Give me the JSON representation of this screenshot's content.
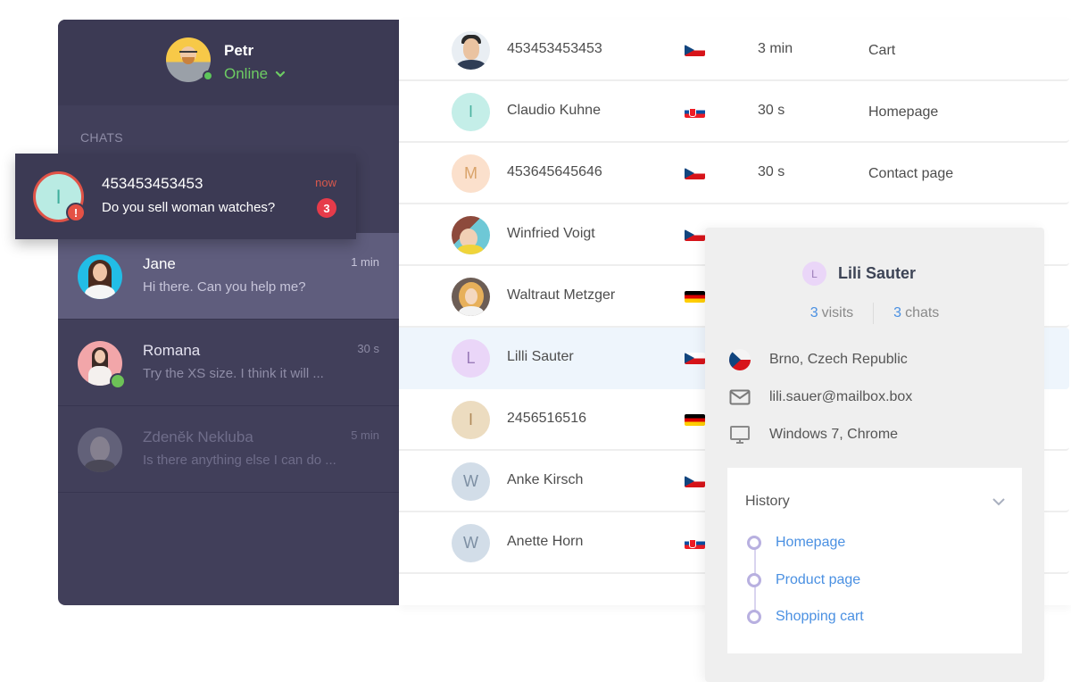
{
  "operator": {
    "name": "Petr",
    "status": "Online",
    "status_color": "#6dcc63"
  },
  "sidebar": {
    "section_label": "CHATS",
    "notification": {
      "avatar_letter": "I",
      "title": "453453453453",
      "message": "Do you sell woman watches?",
      "time": "now",
      "unread_count": "3",
      "alert_icon": "!"
    },
    "chats": [
      {
        "name": "Jane",
        "message": "Hi there. Can you help me?",
        "time": "1 min",
        "state": "active"
      },
      {
        "name": "Romana",
        "message": "Try the XS size. I think it will ...",
        "time": "30 s",
        "state": "normal",
        "badge": "message-icon"
      },
      {
        "name": "Zdeněk Nekluba",
        "message": "Is there anything else I can do ...",
        "time": "5 min",
        "state": "dim"
      }
    ]
  },
  "visitors": [
    {
      "avatar": "photo",
      "letter": "",
      "name": "453453453453",
      "country": "cz",
      "time": "3 min",
      "page": "Cart"
    },
    {
      "avatar": "letter",
      "letter": "I",
      "avatar_bg": "#c4eee8",
      "avatar_fg": "#4bb3a1",
      "name": "Claudio Kuhne",
      "country": "sk",
      "time": "30 s",
      "page": "Homepage"
    },
    {
      "avatar": "letter",
      "letter": "M",
      "avatar_bg": "#fbe0cc",
      "avatar_fg": "#d9a36a",
      "name": "453645645646",
      "country": "cz",
      "time": "30 s",
      "page": "Contact page"
    },
    {
      "avatar": "photo",
      "letter": "",
      "name": "Winfried Voigt",
      "country": "cz",
      "time": "",
      "page": ""
    },
    {
      "avatar": "photo",
      "letter": "",
      "name": "Waltraut Metzger",
      "country": "de",
      "time": "",
      "page": ""
    },
    {
      "avatar": "letter",
      "letter": "L",
      "avatar_bg": "#ead6f8",
      "avatar_fg": "#9a7bb8",
      "name": "Lilli Sauter",
      "country": "cz",
      "time": "",
      "page": "",
      "highlight": true
    },
    {
      "avatar": "letter",
      "letter": "I",
      "avatar_bg": "#ecdcc0",
      "avatar_fg": "#b08a5a",
      "name": "2456516516",
      "country": "de",
      "time": "",
      "page": ""
    },
    {
      "avatar": "letter",
      "letter": "W",
      "avatar_bg": "#d2dde8",
      "avatar_fg": "#7d8fa3",
      "name": "Anke Kirsch",
      "country": "cz",
      "time": "",
      "page": ""
    },
    {
      "avatar": "letter",
      "letter": "W",
      "avatar_bg": "#d2dde8",
      "avatar_fg": "#7d8fa3",
      "name": "Anette Horn",
      "country": "sk",
      "time": "",
      "page": ""
    }
  ],
  "detail": {
    "avatar_letter": "L",
    "name": "Lili Sauter",
    "visits_count": "3",
    "visits_label": "visits",
    "chats_count": "3",
    "chats_label": "chats",
    "location": "Brno, Czech Republic",
    "email": "lili.sauer@mailbox.box",
    "system": "Windows 7, Chrome",
    "history_title": "History",
    "history": [
      "Homepage",
      "Product page",
      "Shopping cart"
    ],
    "link_color": "#4a90e2"
  }
}
